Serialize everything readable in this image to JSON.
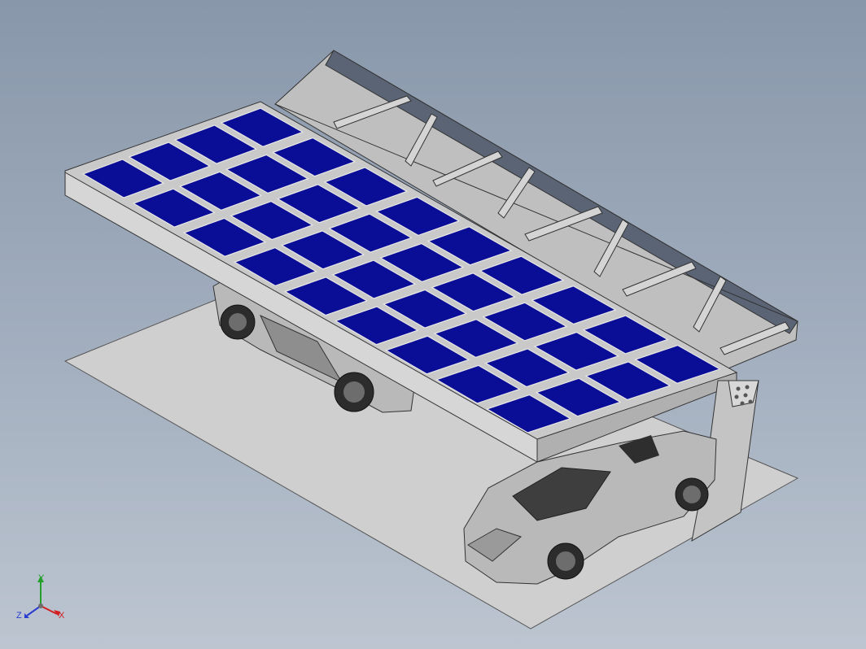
{
  "viewport": {
    "background_top": "#8897aa",
    "background_bottom": "#bcc5d0"
  },
  "model": {
    "panel_color": "#0a0d96",
    "frame_color": "#c9c9c9",
    "truss_color": "#b8b8b8",
    "floor_color": "#cfcfcf",
    "car_color": "#b9b9b9",
    "panel_columns": 4,
    "panel_rows": 9
  },
  "triad": {
    "x_label": "X",
    "y_label": "Y",
    "z_label": "Z",
    "x_color": "#d21e1e",
    "y_color": "#22a02a",
    "z_color": "#2a3ccf",
    "icon": "coordinate-axes-icon"
  }
}
